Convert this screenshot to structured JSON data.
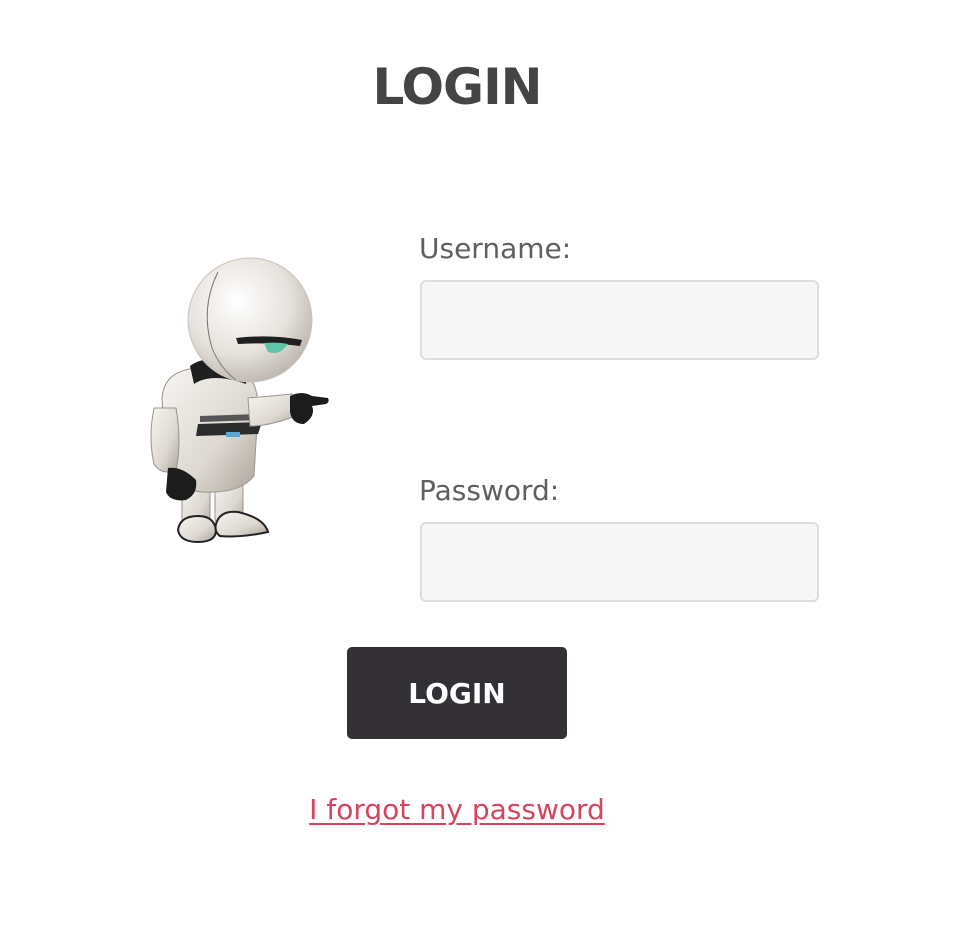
{
  "header": {
    "title": "LOGIN"
  },
  "form": {
    "username_label": "Username:",
    "username_value": "",
    "password_label": "Password:",
    "password_value": "",
    "submit_label": "LOGIN",
    "forgot_link": "I forgot my password"
  },
  "colors": {
    "title": "#444444",
    "button_bg": "#333036",
    "link": "#d9435e",
    "input_bg": "#f6f6f6",
    "input_border": "#dddddd"
  },
  "illustration": {
    "icon": "robot-mascot-icon"
  }
}
